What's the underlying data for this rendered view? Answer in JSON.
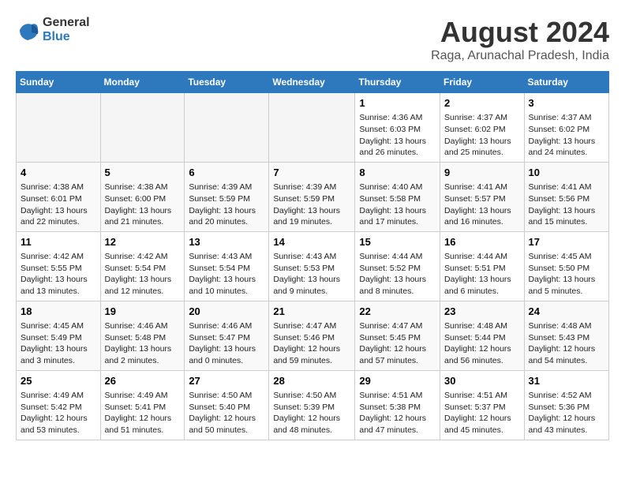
{
  "logo": {
    "general": "General",
    "blue": "Blue"
  },
  "title": "August 2024",
  "subtitle": "Raga, Arunachal Pradesh, India",
  "days_of_week": [
    "Sunday",
    "Monday",
    "Tuesday",
    "Wednesday",
    "Thursday",
    "Friday",
    "Saturday"
  ],
  "weeks": [
    [
      {
        "day": "",
        "detail": ""
      },
      {
        "day": "",
        "detail": ""
      },
      {
        "day": "",
        "detail": ""
      },
      {
        "day": "",
        "detail": ""
      },
      {
        "day": "1",
        "detail": "Sunrise: 4:36 AM\nSunset: 6:03 PM\nDaylight: 13 hours\nand 26 minutes."
      },
      {
        "day": "2",
        "detail": "Sunrise: 4:37 AM\nSunset: 6:02 PM\nDaylight: 13 hours\nand 25 minutes."
      },
      {
        "day": "3",
        "detail": "Sunrise: 4:37 AM\nSunset: 6:02 PM\nDaylight: 13 hours\nand 24 minutes."
      }
    ],
    [
      {
        "day": "4",
        "detail": "Sunrise: 4:38 AM\nSunset: 6:01 PM\nDaylight: 13 hours\nand 22 minutes."
      },
      {
        "day": "5",
        "detail": "Sunrise: 4:38 AM\nSunset: 6:00 PM\nDaylight: 13 hours\nand 21 minutes."
      },
      {
        "day": "6",
        "detail": "Sunrise: 4:39 AM\nSunset: 5:59 PM\nDaylight: 13 hours\nand 20 minutes."
      },
      {
        "day": "7",
        "detail": "Sunrise: 4:39 AM\nSunset: 5:59 PM\nDaylight: 13 hours\nand 19 minutes."
      },
      {
        "day": "8",
        "detail": "Sunrise: 4:40 AM\nSunset: 5:58 PM\nDaylight: 13 hours\nand 17 minutes."
      },
      {
        "day": "9",
        "detail": "Sunrise: 4:41 AM\nSunset: 5:57 PM\nDaylight: 13 hours\nand 16 minutes."
      },
      {
        "day": "10",
        "detail": "Sunrise: 4:41 AM\nSunset: 5:56 PM\nDaylight: 13 hours\nand 15 minutes."
      }
    ],
    [
      {
        "day": "11",
        "detail": "Sunrise: 4:42 AM\nSunset: 5:55 PM\nDaylight: 13 hours\nand 13 minutes."
      },
      {
        "day": "12",
        "detail": "Sunrise: 4:42 AM\nSunset: 5:54 PM\nDaylight: 13 hours\nand 12 minutes."
      },
      {
        "day": "13",
        "detail": "Sunrise: 4:43 AM\nSunset: 5:54 PM\nDaylight: 13 hours\nand 10 minutes."
      },
      {
        "day": "14",
        "detail": "Sunrise: 4:43 AM\nSunset: 5:53 PM\nDaylight: 13 hours\nand 9 minutes."
      },
      {
        "day": "15",
        "detail": "Sunrise: 4:44 AM\nSunset: 5:52 PM\nDaylight: 13 hours\nand 8 minutes."
      },
      {
        "day": "16",
        "detail": "Sunrise: 4:44 AM\nSunset: 5:51 PM\nDaylight: 13 hours\nand 6 minutes."
      },
      {
        "day": "17",
        "detail": "Sunrise: 4:45 AM\nSunset: 5:50 PM\nDaylight: 13 hours\nand 5 minutes."
      }
    ],
    [
      {
        "day": "18",
        "detail": "Sunrise: 4:45 AM\nSunset: 5:49 PM\nDaylight: 13 hours\nand 3 minutes."
      },
      {
        "day": "19",
        "detail": "Sunrise: 4:46 AM\nSunset: 5:48 PM\nDaylight: 13 hours\nand 2 minutes."
      },
      {
        "day": "20",
        "detail": "Sunrise: 4:46 AM\nSunset: 5:47 PM\nDaylight: 13 hours\nand 0 minutes."
      },
      {
        "day": "21",
        "detail": "Sunrise: 4:47 AM\nSunset: 5:46 PM\nDaylight: 12 hours\nand 59 minutes."
      },
      {
        "day": "22",
        "detail": "Sunrise: 4:47 AM\nSunset: 5:45 PM\nDaylight: 12 hours\nand 57 minutes."
      },
      {
        "day": "23",
        "detail": "Sunrise: 4:48 AM\nSunset: 5:44 PM\nDaylight: 12 hours\nand 56 minutes."
      },
      {
        "day": "24",
        "detail": "Sunrise: 4:48 AM\nSunset: 5:43 PM\nDaylight: 12 hours\nand 54 minutes."
      }
    ],
    [
      {
        "day": "25",
        "detail": "Sunrise: 4:49 AM\nSunset: 5:42 PM\nDaylight: 12 hours\nand 53 minutes."
      },
      {
        "day": "26",
        "detail": "Sunrise: 4:49 AM\nSunset: 5:41 PM\nDaylight: 12 hours\nand 51 minutes."
      },
      {
        "day": "27",
        "detail": "Sunrise: 4:50 AM\nSunset: 5:40 PM\nDaylight: 12 hours\nand 50 minutes."
      },
      {
        "day": "28",
        "detail": "Sunrise: 4:50 AM\nSunset: 5:39 PM\nDaylight: 12 hours\nand 48 minutes."
      },
      {
        "day": "29",
        "detail": "Sunrise: 4:51 AM\nSunset: 5:38 PM\nDaylight: 12 hours\nand 47 minutes."
      },
      {
        "day": "30",
        "detail": "Sunrise: 4:51 AM\nSunset: 5:37 PM\nDaylight: 12 hours\nand 45 minutes."
      },
      {
        "day": "31",
        "detail": "Sunrise: 4:52 AM\nSunset: 5:36 PM\nDaylight: 12 hours\nand 43 minutes."
      }
    ]
  ]
}
